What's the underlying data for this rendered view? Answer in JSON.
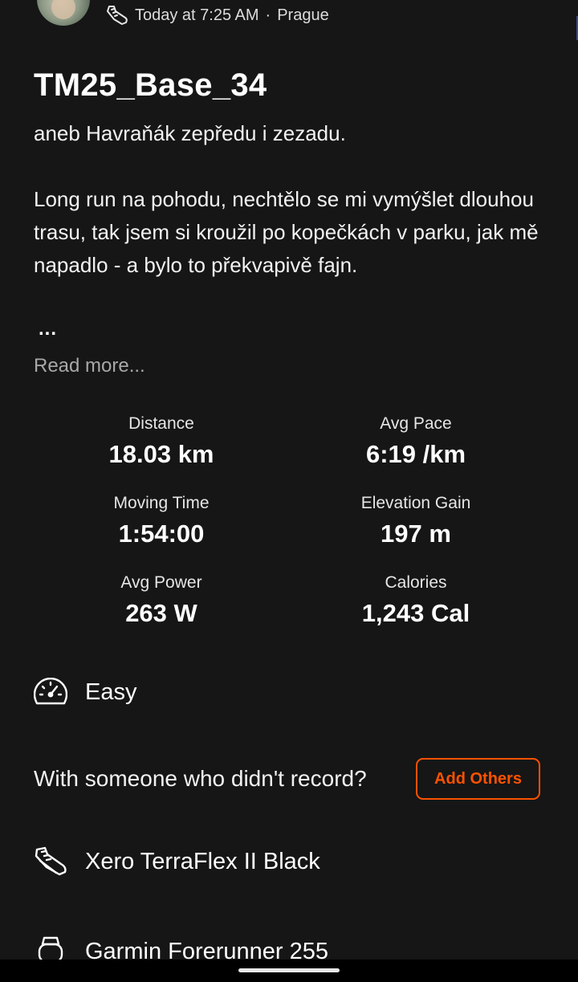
{
  "header": {
    "time": "Today at 7:25 AM",
    "separator": "·",
    "location": "Prague"
  },
  "activity": {
    "title": "TM25_Base_34",
    "description_lines": [
      "aneb Havraňák zepředu i zezadu.",
      "Long run na pohodu, nechtělo se mi vymýšlet dlouhou trasu, tak jsem si kroužil po kopečkách v parku, jak mě napadlo - a bylo to překvapivě fajn."
    ],
    "ellipsis": "...",
    "read_more": "Read more..."
  },
  "stats": [
    {
      "label": "Distance",
      "value": "18.03 km"
    },
    {
      "label": "Avg Pace",
      "value": "6:19 /km"
    },
    {
      "label": "Moving Time",
      "value": "1:54:00"
    },
    {
      "label": "Elevation Gain",
      "value": "197 m"
    },
    {
      "label": "Avg Power",
      "value": "263 W"
    },
    {
      "label": "Calories",
      "value": "1,243 Cal"
    }
  ],
  "effort": {
    "label": "Easy",
    "icon": "speedometer-icon"
  },
  "group": {
    "prompt": "With someone who didn't record?",
    "button_label": "Add Others"
  },
  "gear": {
    "label": "Xero TerraFlex II Black",
    "icon": "shoe-icon"
  },
  "device": {
    "label": "Garmin Forerunner 255",
    "icon": "watch-icon"
  },
  "colors": {
    "background": "#161616",
    "accent": "#fc5200",
    "text": "#ffffff",
    "muted": "#a8a8a8"
  }
}
